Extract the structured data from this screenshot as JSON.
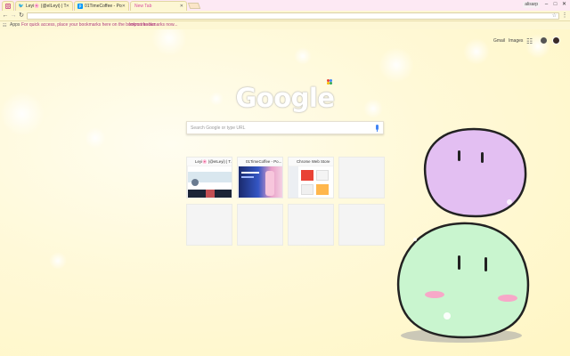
{
  "tabs": [
    {
      "title": "",
      "icon": "instagram-icon"
    },
    {
      "title": "Leyi🌸 (@eILeyi) | Twi",
      "icon": "twitter-icon"
    },
    {
      "title": "01TimeCoffee - Populár",
      "icon": "pixiv-icon"
    },
    {
      "title": "New Tab",
      "icon": "",
      "active": true
    }
  ],
  "window": {
    "profile_name": "alisarp"
  },
  "toolbar": {
    "omnibox_value": ""
  },
  "bookmarks": {
    "apps_label": "Apps",
    "hint": "For quick access, place your bookmarks here on the bookmarks bar.",
    "import_link": "Import bookmarks now..."
  },
  "header": {
    "gmail": "Gmail",
    "images": "Images"
  },
  "logo": {
    "text": "Google"
  },
  "search": {
    "placeholder": "Search Google or type URL"
  },
  "tiles": [
    {
      "title": "Leyi🌸 (@eILeyi) | T...",
      "icon_color": "#1da1f2"
    },
    {
      "title": "01TimeCoffee - Po...",
      "icon_color": "#0096fa"
    },
    {
      "title": "Chrome Web Store",
      "icon_color": "#e94235"
    },
    {
      "title": ""
    },
    {
      "title": ""
    },
    {
      "title": ""
    },
    {
      "title": ""
    },
    {
      "title": ""
    }
  ],
  "colors": {
    "background": "#fff8cc",
    "accent_pink": "#d94ea0",
    "dango_top": "#e3bff2",
    "dango_bottom": "#c9f5cf"
  }
}
